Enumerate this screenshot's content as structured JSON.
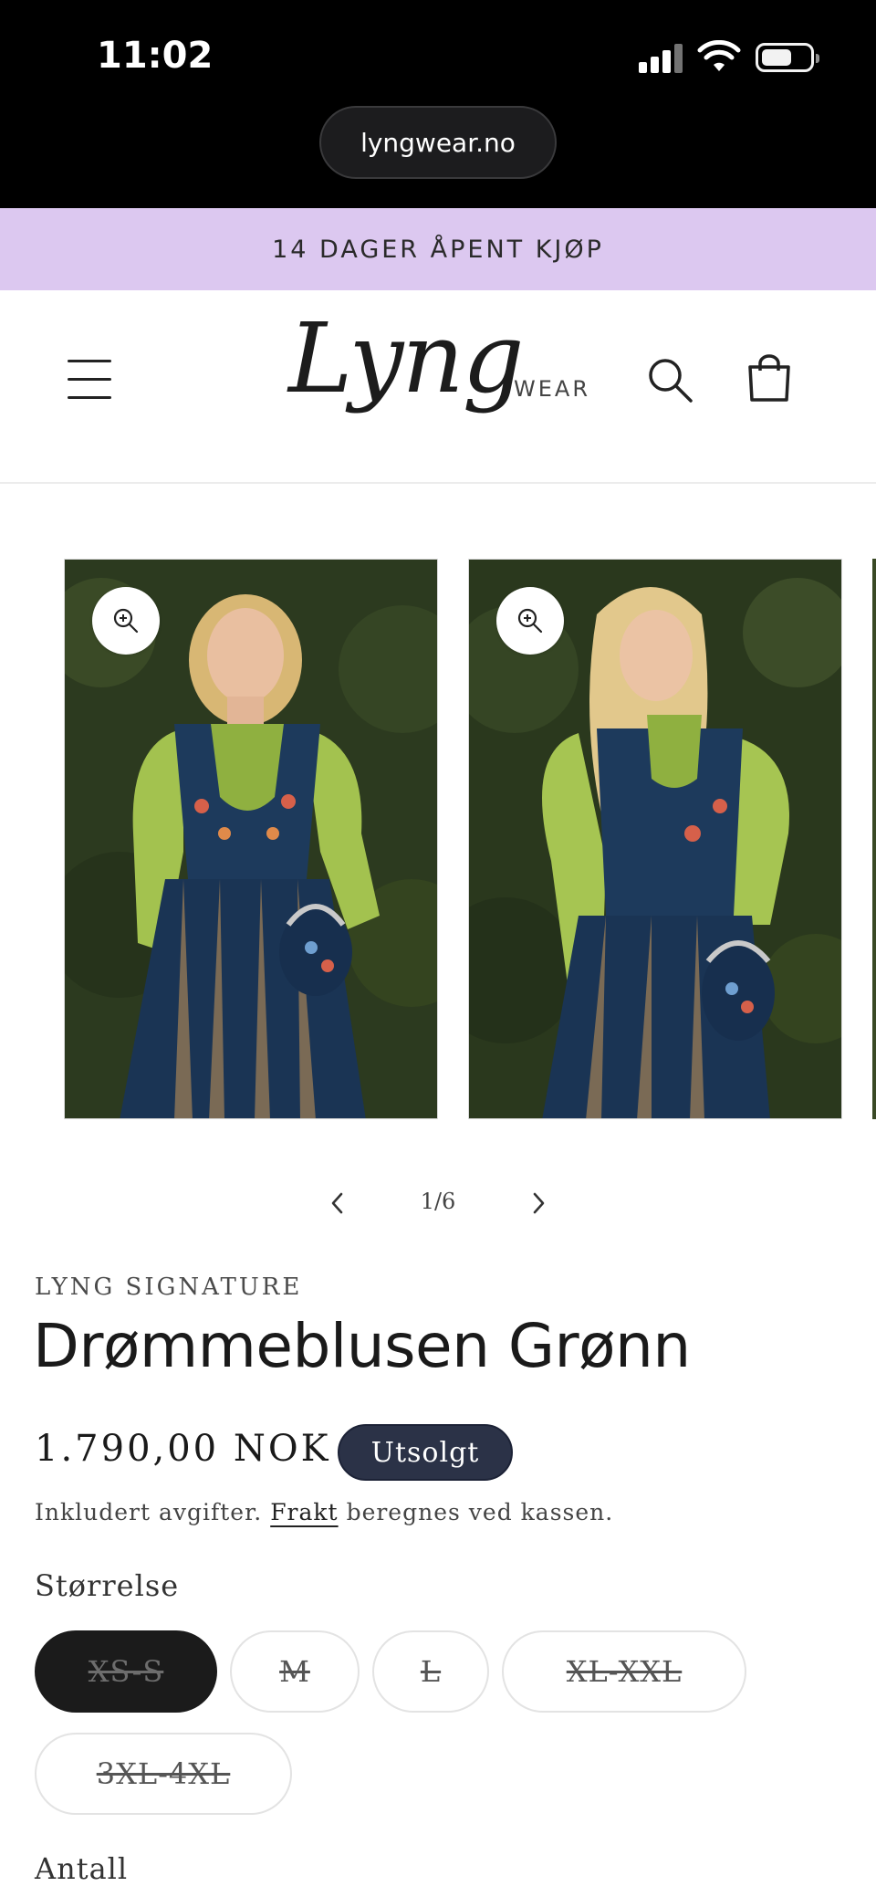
{
  "status_bar": {
    "time": "11:02",
    "url": "lyngwear.no"
  },
  "announcement": {
    "text": "14 DAGER ÅPENT KJØP",
    "background": "#dcc8f0"
  },
  "header": {
    "logo_text": "Lyng",
    "logo_sub": "WEAR"
  },
  "gallery": {
    "slides": [
      {
        "icon": "zoom-in-icon"
      },
      {
        "icon": "zoom-in-icon"
      }
    ],
    "pager": {
      "count": "1/6"
    }
  },
  "product": {
    "vendor": "LYNG SIGNATURE",
    "title": "Drømmeblusen Grønn",
    "price": "1.790,00 NOK",
    "badge": "Utsolgt",
    "tax_prefix": "Inkludert avgifter.",
    "shipping_link": "Frakt",
    "tax_suffix": "beregnes ved kassen.",
    "size_label": "Størrelse",
    "sizes": [
      "XS-S",
      "M",
      "L",
      "XL-XXL",
      "3XL-4XL"
    ],
    "selected_size": "XS-S",
    "quantity_label": "Antall"
  },
  "colors": {
    "badge": "#2b3247",
    "selected_size": "#1b1b1b"
  }
}
